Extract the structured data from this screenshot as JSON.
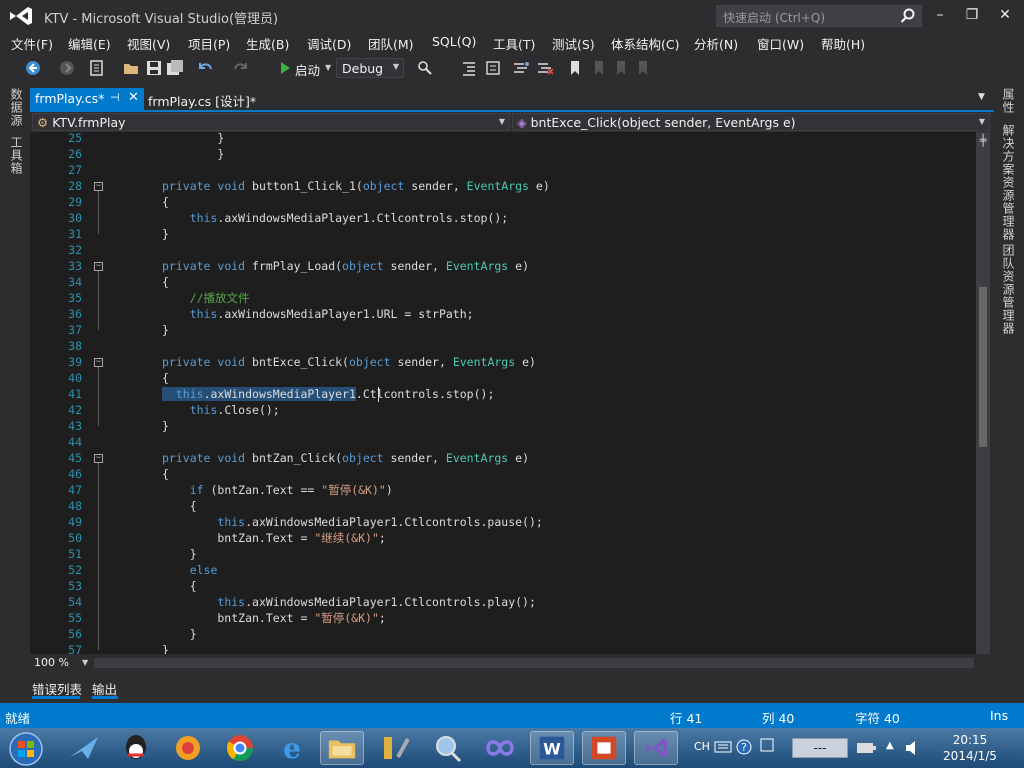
{
  "window": {
    "title": "KTV - Microsoft Visual Studio(管理员)",
    "quick_launch_placeholder": "快速启动 (Ctrl+Q)"
  },
  "menu": [
    "文件(F)",
    "编辑(E)",
    "视图(V)",
    "项目(P)",
    "生成(B)",
    "调试(D)",
    "团队(M)",
    "SQL(Q)",
    "工具(T)",
    "测试(S)",
    "体系结构(C)",
    "分析(N)",
    "窗口(W)",
    "帮助(H)"
  ],
  "toolbar": {
    "start_label": "启动",
    "config": "Debug"
  },
  "left_rail": [
    "数据源",
    "工具箱"
  ],
  "right_rail": [
    "属性",
    "解决方案资源管理器",
    "团队资源管理器"
  ],
  "tabs": {
    "active": "frmPlay.cs*",
    "active_pin": "⊣",
    "inactive": "frmPlay.cs [设计]*"
  },
  "nav": {
    "class": "KTV.frmPlay",
    "member": "bntExce_Click(object sender, EventArgs e)"
  },
  "code_lines": [
    {
      "n": 25,
      "tokens": [
        [
          "",
          "        }"
        ]
      ]
    },
    {
      "n": 26,
      "tokens": [
        [
          "",
          "        }"
        ]
      ]
    },
    {
      "n": 27,
      "tokens": []
    },
    {
      "n": 28,
      "fold": true,
      "tokens": [
        [
          "kw",
          "private"
        ],
        [
          "",
          " "
        ],
        [
          "kw",
          "void"
        ],
        [
          "",
          " button1_Click_1("
        ],
        [
          "kw",
          "object"
        ],
        [
          "",
          " sender, "
        ],
        [
          "ty",
          "EventArgs"
        ],
        [
          "",
          " e)"
        ]
      ]
    },
    {
      "n": 29,
      "tokens": [
        [
          "",
          "{"
        ]
      ]
    },
    {
      "n": 30,
      "tokens": [
        [
          "",
          "    "
        ],
        [
          "kw",
          "this"
        ],
        [
          "",
          ".axWindowsMediaPlayer1.Ctlcontrols.stop();"
        ]
      ]
    },
    {
      "n": 31,
      "tokens": [
        [
          "",
          "}"
        ]
      ]
    },
    {
      "n": 32,
      "tokens": []
    },
    {
      "n": 33,
      "fold": true,
      "tokens": [
        [
          "kw",
          "private"
        ],
        [
          "",
          " "
        ],
        [
          "kw",
          "void"
        ],
        [
          "",
          " frmPlay_Load("
        ],
        [
          "kw",
          "object"
        ],
        [
          "",
          " sender, "
        ],
        [
          "ty",
          "EventArgs"
        ],
        [
          "",
          " e)"
        ]
      ]
    },
    {
      "n": 34,
      "tokens": [
        [
          "",
          "{"
        ]
      ]
    },
    {
      "n": 35,
      "tokens": [
        [
          "",
          "    "
        ],
        [
          "cm",
          "//播放文件"
        ]
      ]
    },
    {
      "n": 36,
      "tokens": [
        [
          "",
          "    "
        ],
        [
          "kw",
          "this"
        ],
        [
          "",
          ".axWindowsMediaPlayer1.URL = strPath;"
        ]
      ]
    },
    {
      "n": 37,
      "tokens": [
        [
          "",
          "}"
        ]
      ]
    },
    {
      "n": 38,
      "tokens": []
    },
    {
      "n": 39,
      "fold": true,
      "tokens": [
        [
          "kw",
          "private"
        ],
        [
          "",
          " "
        ],
        [
          "kw",
          "void"
        ],
        [
          "",
          " bntExce_Click("
        ],
        [
          "kw",
          "object"
        ],
        [
          "",
          " sender, "
        ],
        [
          "ty",
          "EventArgs"
        ],
        [
          "",
          " e)"
        ]
      ]
    },
    {
      "n": 40,
      "tokens": [
        [
          "",
          "{"
        ]
      ]
    },
    {
      "n": 41,
      "tokens": [
        [
          "sel",
          "  "
        ],
        [
          "kw sel",
          "this"
        ],
        [
          "sel",
          ".axWindowsMediaPlayer1"
        ],
        [
          "",
          ".Ctlcontrols.stop();"
        ]
      ]
    },
    {
      "n": 42,
      "tokens": [
        [
          "",
          "    "
        ],
        [
          "kw",
          "this"
        ],
        [
          "",
          ".Close();"
        ]
      ]
    },
    {
      "n": 43,
      "tokens": [
        [
          "",
          "}"
        ]
      ]
    },
    {
      "n": 44,
      "tokens": []
    },
    {
      "n": 45,
      "fold": true,
      "tokens": [
        [
          "kw",
          "private"
        ],
        [
          "",
          " "
        ],
        [
          "kw",
          "void"
        ],
        [
          "",
          " bntZan_Click("
        ],
        [
          "kw",
          "object"
        ],
        [
          "",
          " sender, "
        ],
        [
          "ty",
          "EventArgs"
        ],
        [
          "",
          " e)"
        ]
      ]
    },
    {
      "n": 46,
      "tokens": [
        [
          "",
          "{"
        ]
      ]
    },
    {
      "n": 47,
      "tokens": [
        [
          "",
          "    "
        ],
        [
          "kw",
          "if"
        ],
        [
          "",
          " (bntZan.Text == "
        ],
        [
          "st",
          "\"暂停(&K)\""
        ],
        [
          "",
          ")"
        ]
      ]
    },
    {
      "n": 48,
      "tokens": [
        [
          "",
          "    {"
        ]
      ]
    },
    {
      "n": 49,
      "tokens": [
        [
          "",
          "        "
        ],
        [
          "kw",
          "this"
        ],
        [
          "",
          ".axWindowsMediaPlayer1.Ctlcontrols.pause();"
        ]
      ]
    },
    {
      "n": 50,
      "tokens": [
        [
          "",
          "        bntZan.Text = "
        ],
        [
          "st",
          "\"继续(&K)\""
        ],
        [
          "",
          ";"
        ]
      ]
    },
    {
      "n": 51,
      "tokens": [
        [
          "",
          "    }"
        ]
      ]
    },
    {
      "n": 52,
      "tokens": [
        [
          "",
          "    "
        ],
        [
          "kw",
          "else"
        ]
      ]
    },
    {
      "n": 53,
      "tokens": [
        [
          "",
          "    {"
        ]
      ]
    },
    {
      "n": 54,
      "tokens": [
        [
          "",
          "        "
        ],
        [
          "kw",
          "this"
        ],
        [
          "",
          ".axWindowsMediaPlayer1.Ctlcontrols.play();"
        ]
      ]
    },
    {
      "n": 55,
      "tokens": [
        [
          "",
          "        bntZan.Text = "
        ],
        [
          "st",
          "\"暂停(&K)\""
        ],
        [
          "",
          ";"
        ]
      ]
    },
    {
      "n": 56,
      "tokens": [
        [
          "",
          "    }"
        ]
      ]
    },
    {
      "n": 57,
      "tokens": [
        [
          "",
          "}"
        ]
      ]
    }
  ],
  "editor": {
    "zoom": "100 %"
  },
  "bottom_tabs": [
    "错误列表",
    "输出"
  ],
  "status": {
    "state": "就绪",
    "line": "行 41",
    "col": "列 40",
    "char": "字符 40",
    "mode": "Ins"
  },
  "taskbar": {
    "apps": [
      "start-orb",
      "feiq-icon",
      "qq-icon",
      "gift-icon",
      "chrome-icon",
      "ie-icon",
      "explorer-icon",
      "tools-icon",
      "magnifier-icon",
      "infinity-icon",
      "word-icon",
      "powerpoint-icon",
      "visual-studio-icon"
    ],
    "ime": "CH",
    "mini_widget": "---",
    "time": "20:15",
    "date": "2014/1/5"
  },
  "colors": {
    "accent": "#007acc",
    "editor_bg": "#1e1e1e",
    "chrome_bg": "#2d2d30"
  }
}
